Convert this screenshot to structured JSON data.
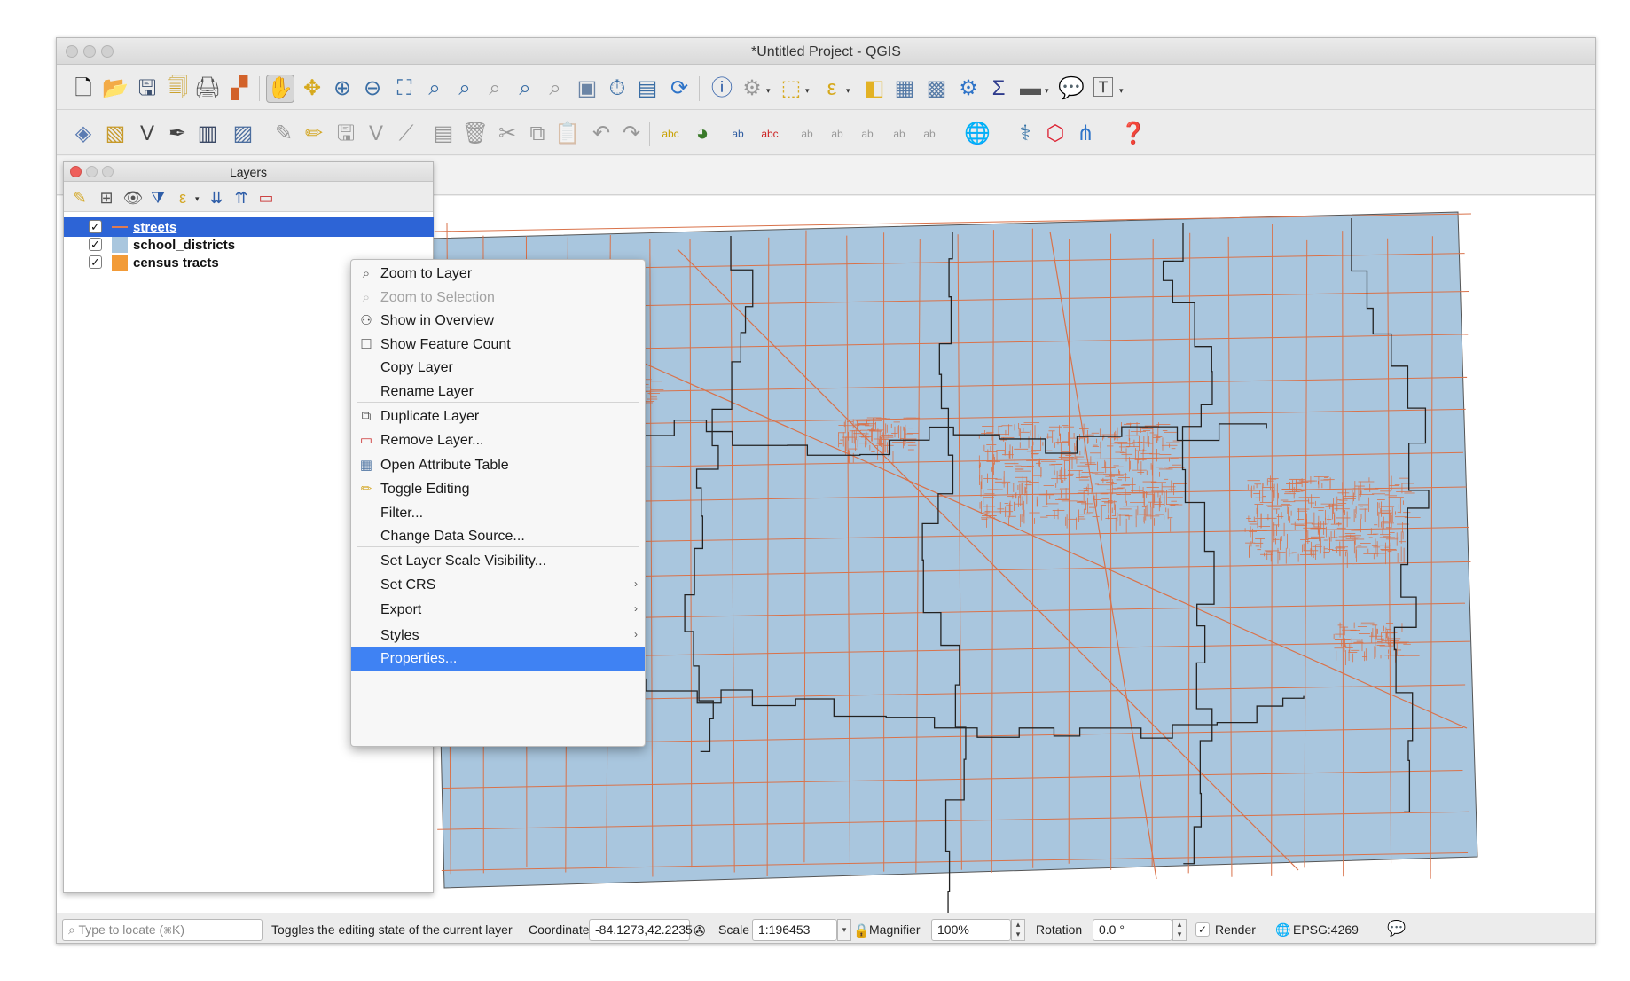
{
  "window": {
    "title": "*Untitled Project - QGIS"
  },
  "toolbar1": {
    "items": [
      "new-project-icon",
      "open-project-icon",
      "save-project-icon",
      "save-as-icon",
      "print-layout-icon",
      "style-manager-icon",
      "pan-icon",
      "pan-to-selection-icon",
      "zoom-in-icon",
      "zoom-out-icon",
      "zoom-full-icon",
      "zoom-to-selection-icon",
      "zoom-to-layer-icon",
      "zoom-native-icon",
      "zoom-last-icon",
      "zoom-next-icon",
      "new-map-view-icon",
      "temporal-controller-icon",
      "bookmark-icon",
      "refresh-icon",
      "identify-icon",
      "actions-icon",
      "select-icon",
      "select-value-icon",
      "deselect-icon",
      "attribute-table-icon",
      "field-calculator-icon",
      "processing-icon",
      "statistics-icon",
      "measure-icon",
      "map-tips-icon",
      "text-annotation-icon"
    ]
  },
  "toolbar2": {
    "items": [
      "add-vector-layer-icon",
      "add-raster-layer-icon",
      "add-delimited-text-icon",
      "add-spatialite-icon",
      "virtual-layer-icon",
      "data-source-manager-icon",
      "current-edits-icon",
      "toggle-editing-icon",
      "save-edits-icon",
      "add-feature-icon",
      "vertex-tool-icon",
      "modify-attributes-icon",
      "delete-selected-icon",
      "cut-features-icon",
      "copy-features-icon",
      "paste-features-icon",
      "undo-icon",
      "redo-icon",
      "label-tool-icon",
      "diagram-tool-icon",
      "highlight-labels-icon",
      "pin-labels-icon",
      "show-hide-labels-icon",
      "move-label-icon",
      "rotate-label-icon",
      "change-label-icon",
      "label-properties-icon",
      "plugin-globe-icon",
      "python-console-icon",
      "geometry-checker-icon",
      "graph-plugin-icon",
      "help-icon"
    ]
  },
  "layers_panel": {
    "title": "Layers",
    "tools": [
      "style-panel-icon",
      "add-group-icon",
      "manage-visibility-icon",
      "filter-legend-icon",
      "filter-expression-icon",
      "expand-all-icon",
      "collapse-all-icon",
      "remove-layer-icon"
    ],
    "layers": [
      {
        "name": "streets",
        "checked": "✓",
        "swatch": "#e07b4f",
        "selected": true
      },
      {
        "name": "school_districts",
        "checked": "✓",
        "swatch": "#a9c6de"
      },
      {
        "name": "census tracts",
        "checked": "✓",
        "swatch": "#f29b38"
      }
    ]
  },
  "context_menu": {
    "items": [
      {
        "label": "Zoom to Layer",
        "icon": "zoom-layer-icon"
      },
      {
        "label": "Zoom to Selection",
        "icon": "zoom-selection-icon",
        "disabled": true
      },
      {
        "label": "Show in Overview",
        "icon": "overview-icon"
      },
      {
        "label": "Show Feature Count",
        "icon": "checkbox-icon"
      },
      {
        "label": "Copy Layer"
      },
      {
        "label": "Rename Layer"
      },
      {
        "label": "Duplicate Layer",
        "icon": "duplicate-icon"
      },
      {
        "label": "Remove Layer...",
        "icon": "remove-icon"
      },
      {
        "label": "Open Attribute Table",
        "icon": "table-icon"
      },
      {
        "label": "Toggle Editing",
        "icon": "pencil-icon"
      },
      {
        "label": "Filter..."
      },
      {
        "label": "Change Data Source..."
      },
      {
        "label": "Set Layer Scale Visibility..."
      },
      {
        "label": "Set CRS",
        "submenu": true
      },
      {
        "label": "Export",
        "submenu": true
      },
      {
        "label": "Styles",
        "submenu": true
      },
      {
        "label": "Properties...",
        "highlight": true
      }
    ],
    "submenu_arrow": "›"
  },
  "statusbar": {
    "locate_placeholder": "Type to locate (⌘K)",
    "message": "Toggles the editing state of the current layer",
    "coordinate_label": "Coordinate",
    "coordinate_value": "-84.1273,42.2235",
    "scale_label": "Scale",
    "scale_value": "1:196453",
    "magnifier_label": "Magnifier",
    "magnifier_value": "100%",
    "rotation_label": "Rotation",
    "rotation_value": "0.0 °",
    "render_label": "Render",
    "render_checked": "✓",
    "crs_label": "EPSG:4269"
  },
  "map": {
    "fill_color": "#a9c6de",
    "district_line_color": "#222222",
    "street_color": "#d9724a"
  }
}
